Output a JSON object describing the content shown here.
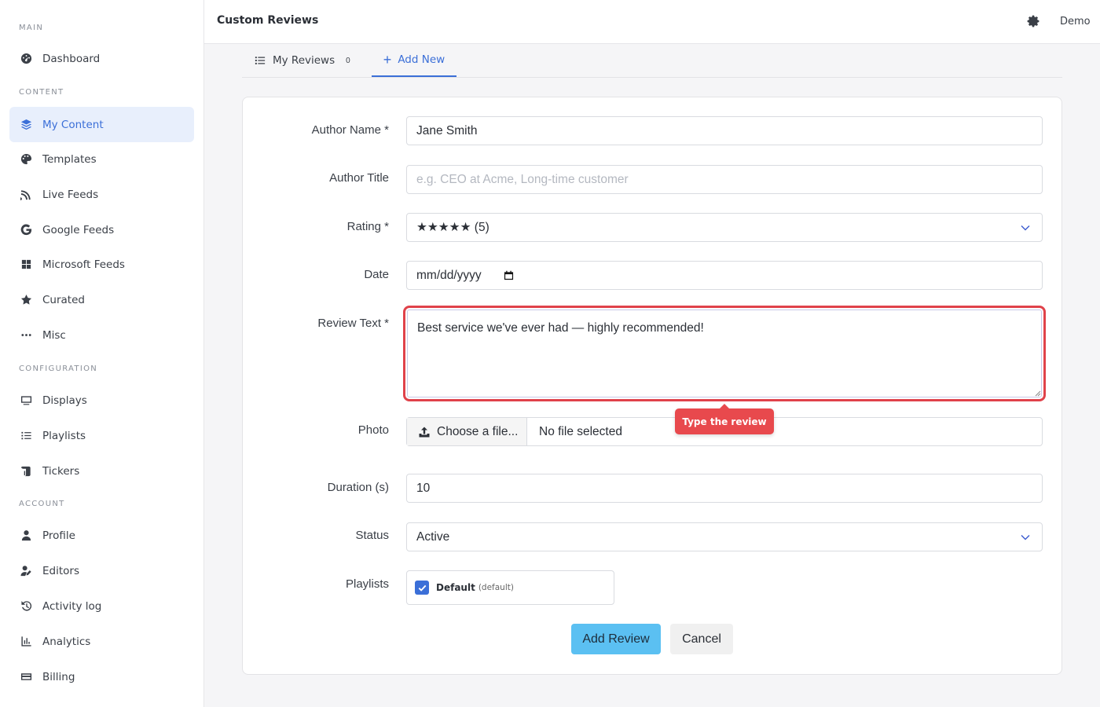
{
  "sidebar": {
    "sections": {
      "main": "MAIN",
      "content": "CONTENT",
      "configuration": "CONFIGURATION",
      "account": "ACCOUNT"
    },
    "items": {
      "dashboard": "Dashboard",
      "my_content": "My Content",
      "templates": "Templates",
      "live_feeds": "Live Feeds",
      "google_feeds": "Google Feeds",
      "microsoft_feeds": "Microsoft Feeds",
      "curated": "Curated",
      "misc": "Misc",
      "displays": "Displays",
      "playlists": "Playlists",
      "tickers": "Tickers",
      "profile": "Profile",
      "editors": "Editors",
      "activity_log": "Activity log",
      "analytics": "Analytics",
      "billing": "Billing"
    },
    "active_item": "my_content",
    "accent_color": "#3b6fd8"
  },
  "header": {
    "title": "Custom Reviews",
    "user": "Demo",
    "settings_icon": "gear-icon"
  },
  "tabs": {
    "my_reviews": {
      "label": "My Reviews",
      "count": "0"
    },
    "add_new": {
      "label": "Add New",
      "active": true
    }
  },
  "form": {
    "author_name": {
      "label": "Author Name *",
      "value": "Jane Smith"
    },
    "author_title": {
      "label": "Author Title",
      "placeholder": "e.g. CEO at Acme, Long-time customer"
    },
    "rating": {
      "label": "Rating *",
      "value": "★★★★★ (5)"
    },
    "date": {
      "label": "Date",
      "placeholder": "mm/dd/yyyy"
    },
    "review_text": {
      "label": "Review Text *",
      "value": "Best service we've ever had — highly recommended!"
    },
    "photo": {
      "label": "Photo",
      "button": "Choose a file...",
      "file_name": "No file selected"
    },
    "duration": {
      "label": "Duration (s)",
      "value": "10"
    },
    "status": {
      "label": "Status",
      "value": "Active"
    },
    "playlists": {
      "label": "Playlists",
      "option": "Default",
      "option_note": "(default)",
      "checked": true
    }
  },
  "tooltip": {
    "text": "Type the review",
    "color": "#e8494d"
  },
  "actions": {
    "submit": "Add Review",
    "cancel": "Cancel",
    "submit_color": "#5bc0f2"
  }
}
